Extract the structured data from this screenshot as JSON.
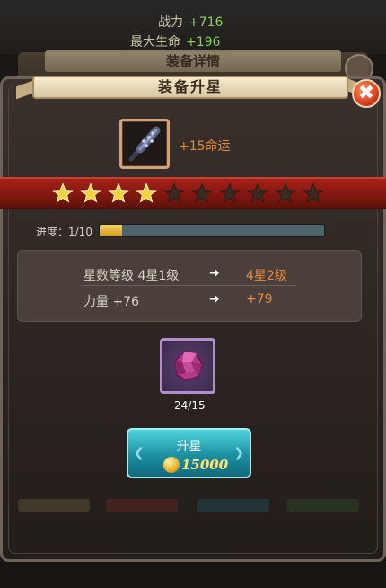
{
  "background_stats": {
    "power_label": "战力",
    "power_value": "+716",
    "hp_label": "最大生命",
    "hp_value": "+196",
    "back_dialog_title": "装备详情"
  },
  "dialog": {
    "title": "装备升星",
    "close_glyph": "✖"
  },
  "item": {
    "icon": "spiked-mace-icon",
    "bonus": "+15命运"
  },
  "stars": {
    "filled": 4,
    "total": 10,
    "filled_color": "#f6d23b",
    "empty_color": "#3a2a22"
  },
  "progress": {
    "label": "进度：1/10",
    "current": 1,
    "max": 10
  },
  "stats": {
    "rows": [
      {
        "name": "星数等级 4星1级",
        "new": "4星2级"
      },
      {
        "name": "力量 +76",
        "new": "+79"
      }
    ]
  },
  "material": {
    "icon": "purple-gem-icon",
    "count": "24/15"
  },
  "upgrade_button": {
    "label": "升星",
    "cost": "15000",
    "coin_icon": "gold-coin-icon"
  },
  "colors": {
    "accent_orange": "#e68a3a",
    "stat_green": "#86d45a",
    "band_red": "#a52118",
    "button_teal": "#1b8fa3"
  }
}
